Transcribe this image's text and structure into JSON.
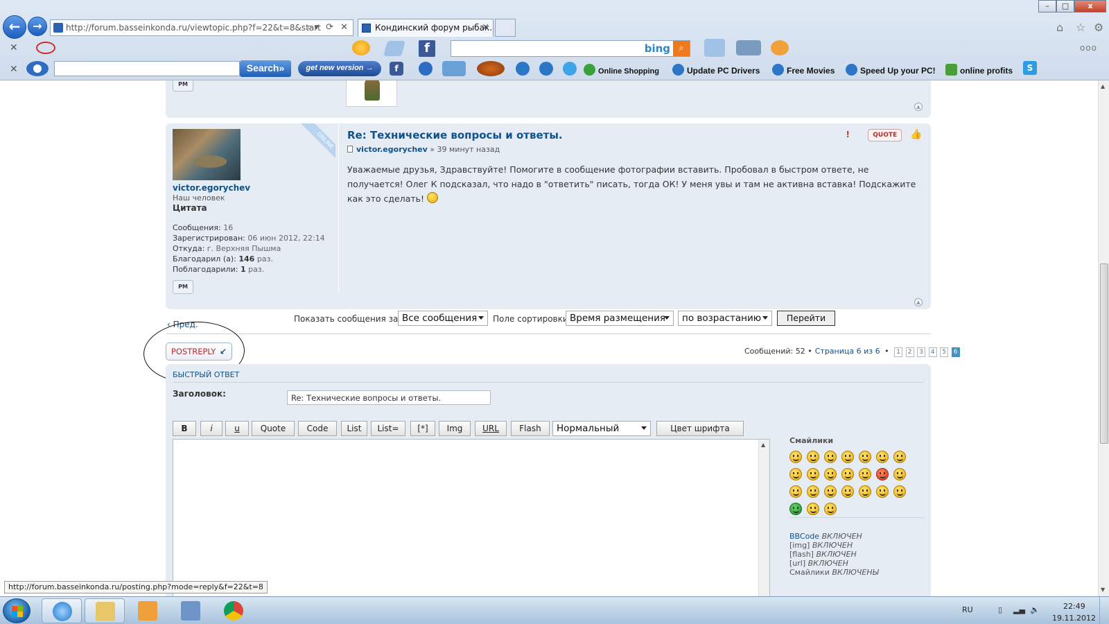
{
  "browser": {
    "address_url": "http://forum.basseinkonda.ru/viewtopic.php?f=22&t=8&start",
    "tab_title": "Кондинский форум рыбак...",
    "tab_close": "×",
    "window_controls": {
      "minimize": "–",
      "maximize": "□",
      "close": "x"
    }
  },
  "toolbar": {
    "bing_logo": "bing",
    "search_button": "Search»",
    "get_new_version": "get new version →",
    "links": [
      "Online Shopping",
      "Update PC Drivers",
      "Free Movies",
      "Speed Up your PC!",
      "online profits"
    ],
    "more": "ooo"
  },
  "forum": {
    "post": {
      "title": "Re: Технические вопросы и ответы.",
      "author": "victor.egorychev",
      "time": "» 39 минут назад",
      "content": "Уважаемые друзья, Здравствуйте! Помогите в сообщение фотографии вставить. Пробовал в быстром ответе, не получается! Олег К подсказал, что надо в \"ответить\" писать, тогда ОК! У меня увы и там не активна вставка! Подскажите как это сделать!",
      "quote_label": "QUOTE",
      "report_icon": "!",
      "thanks_icon": "👍",
      "online_label": "ONLINE",
      "top_icon": "▲",
      "pm_label": "PM"
    },
    "profile": {
      "username": "victor.egorychev",
      "rank": "Наш человек",
      "title": "Цитата",
      "posts_label": "Сообщения:",
      "posts_value": "16",
      "registered_label": "Зарегистрирован:",
      "registered_value": "06 июн 2012, 22:14",
      "from_label": "Откуда:",
      "from_value": "г. Верхняя Пышма",
      "thanked_label": "Благодарил (а):",
      "thanked_count": "146",
      "thanked_suffix": "раз.",
      "was_thanked_label": "Поблагодарили:",
      "was_thanked_count": "1",
      "was_thanked_suffix": "раз."
    },
    "sort_bar": {
      "prev": "‹ Пред.",
      "show_label": "Показать сообщения за:",
      "show_value": "Все сообщения",
      "sort_label": "Поле сортировки",
      "sort_value": "Время размещения",
      "order_value": "по возрастанию",
      "go_button": "Перейти"
    },
    "reply_button": {
      "post": "POST",
      "reply": "REPLY",
      "icon": "↙"
    },
    "pagination": {
      "summary": "Сообщений: 52 •",
      "current": "Страница 6 из 6",
      "separator": "•",
      "pages": [
        "1",
        "2",
        "3",
        "4",
        "5",
        "6"
      ],
      "active_page": "6"
    },
    "quick_reply": {
      "heading": "БЫСТРЫЙ ОТВЕТ",
      "subject_label": "Заголовок:",
      "subject_value": "Re: Технические вопросы и ответы.",
      "buttons": [
        "B",
        "i",
        "u",
        "Quote",
        "Code",
        "List",
        "List=",
        "[*]",
        "Img",
        "URL",
        "Flash"
      ],
      "font_size_value": "Нормальный",
      "font_color_button": "Цвет шрифта",
      "smilies_title": "Смайлики",
      "bbcode_link": "BBCode",
      "bbcode_state": "ВКЛЮЧЕН",
      "img_label": "[img]",
      "img_state": "ВКЛЮЧЕН",
      "flash_label": "[flash]",
      "flash_state": "ВКЛЮЧЕН",
      "url_label": "[url]",
      "url_state": "ВКЛЮЧЕН",
      "smilies_label": "Смайлики",
      "smilies_state": "ВКЛЮЧЕНЫ"
    }
  },
  "status_bar": {
    "hover_url": "http://forum.basseinkonda.ru/posting.php?mode=reply&f=22&t=8"
  },
  "taskbar": {
    "language": "RU",
    "time": "22:49",
    "date": "19.11.2012"
  },
  "colors": {
    "forum_link": "#105289",
    "panel_bg": "#e6ecf3",
    "reply_red": "#b02b2c",
    "page_active": "#4692bf"
  }
}
